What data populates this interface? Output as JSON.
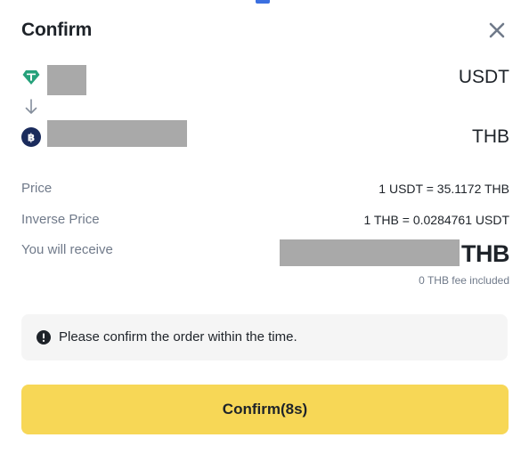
{
  "dialog": {
    "title": "Confirm",
    "close_icon": "close-icon"
  },
  "from": {
    "icon": "tether-icon",
    "icon_color": "#26a17b",
    "symbol": "USDT"
  },
  "to": {
    "icon": "thai-baht-icon",
    "icon_color": "#1a2b5c",
    "symbol": "THB"
  },
  "details": {
    "price_label": "Price",
    "price_value": "1 USDT = 35.1172 THB",
    "inverse_label": "Inverse Price",
    "inverse_value": "1 THB = 0.0284761 USDT",
    "receive_label": "You will receive",
    "receive_symbol": "THB",
    "fee_note": "0 THB fee included"
  },
  "notice": {
    "icon": "exclamation-circle-icon",
    "text": "Please confirm the order within the time."
  },
  "confirm_button": {
    "label": "Confirm(8s)",
    "color": "#f7d756"
  }
}
